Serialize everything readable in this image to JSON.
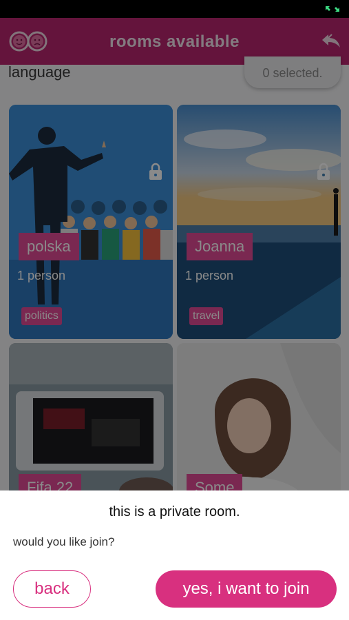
{
  "status_bar": {
    "icon": "expand-arrows-icon",
    "icon_color": "#3ddc84"
  },
  "header": {
    "title": "rooms available",
    "logo_icon": "two-faces-logo-icon",
    "back_icon": "reply-back-arrow-icon",
    "background": "#b9256f"
  },
  "filters": {
    "language_label": "language",
    "selected_label": "0 selected."
  },
  "rooms": [
    {
      "name": "polska",
      "people": "1 person",
      "tag": "politics",
      "locked": true
    },
    {
      "name": "Joanna",
      "people": "1 person",
      "tag": "travel",
      "locked": true
    },
    {
      "name": "Fifa 22"
    },
    {
      "name": "Some"
    }
  ],
  "dialog": {
    "title": "this is a private room.",
    "message": "would you like join?",
    "back_label": "back",
    "join_label": "yes, i want to join",
    "accent_color": "#d8307f"
  }
}
